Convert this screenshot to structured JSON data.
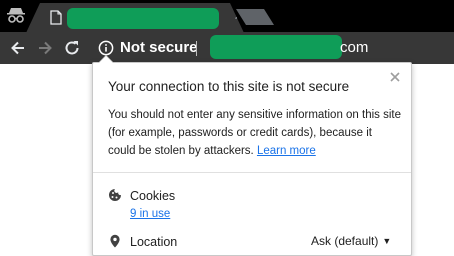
{
  "colors": {
    "tabstrip": "#000000",
    "toolbar": "#373737",
    "redaction": "#0f9d58",
    "link": "#1a73e8"
  },
  "tabstrip": {
    "incognito_icon": "incognito-icon",
    "tab": {
      "favicon": "page-icon",
      "close_icon": "close-icon"
    },
    "new_tab_icon": "new-tab-icon"
  },
  "toolbar": {
    "back_icon": "arrow-left-icon",
    "forward_icon": "arrow-right-icon",
    "reload_icon": "reload-icon",
    "omnibox": {
      "security_icon": "info-icon",
      "security_label": "Not secure",
      "url_suffix": "com"
    }
  },
  "page_info": {
    "title": "Your connection to this site is not secure",
    "body": "You should not enter any sensitive information on this site (for example, passwords or credit cards), because it could be stolen by attackers.",
    "learn_more": "Learn more",
    "close_icon": "close-icon",
    "cookies": {
      "icon": "cookie-icon",
      "label": "Cookies",
      "sub": "9 in use"
    },
    "location": {
      "icon": "location-pin-icon",
      "label": "Location",
      "value": "Ask (default)"
    }
  }
}
